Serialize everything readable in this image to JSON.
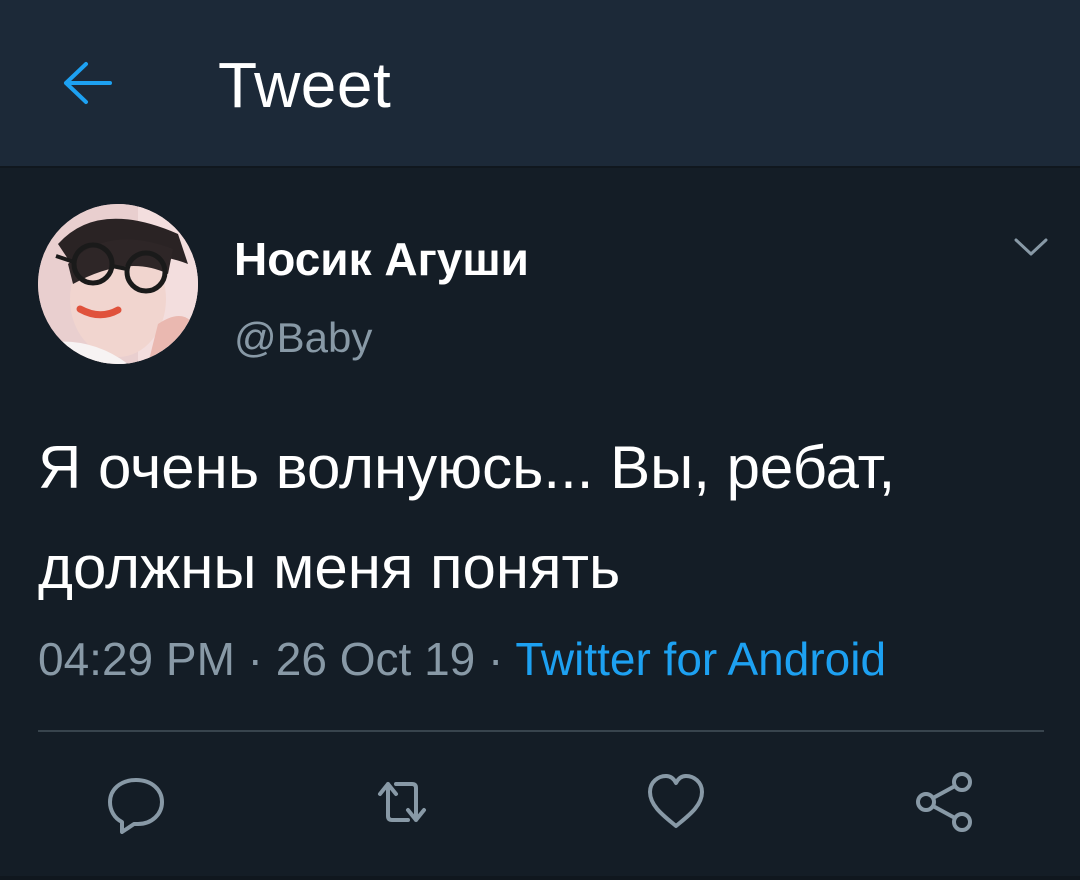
{
  "header": {
    "title": "Tweet",
    "back_icon": "arrow-left-icon"
  },
  "tweet": {
    "display_name": "Носик Агуши",
    "handle": "@Baby",
    "text": "Я очень волнуюсь... Вы, ребат, должны меня понять",
    "time": "04:29 PM",
    "separator": " · ",
    "date": "26 Oct 19",
    "source": "Twitter for Android"
  },
  "actions": {
    "reply_icon": "reply-icon",
    "retweet_icon": "retweet-icon",
    "like_icon": "heart-icon",
    "share_icon": "share-icon"
  },
  "colors": {
    "background": "#141d26",
    "header_bg": "#1c2938",
    "accent": "#1da1f2",
    "secondary_text": "#8899a6"
  }
}
